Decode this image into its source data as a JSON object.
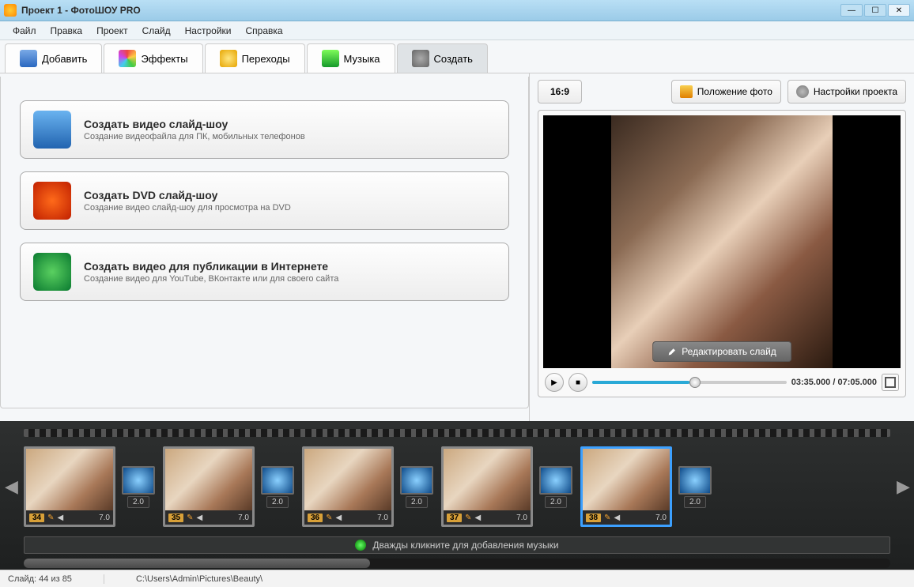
{
  "window": {
    "title": "Проект 1 - ФотоШОУ PRO"
  },
  "menu": [
    "Файл",
    "Правка",
    "Проект",
    "Слайд",
    "Настройки",
    "Справка"
  ],
  "tabs": [
    {
      "label": "Добавить",
      "icon_color": "linear-gradient(#7aa9e6,#2a68c0)"
    },
    {
      "label": "Эффекты",
      "icon_color": "conic-gradient(#e44,#fc4,#4c4,#4ce,#c4e,#e44)"
    },
    {
      "label": "Переходы",
      "icon_color": "radial-gradient(#ffe680,#e6a400)"
    },
    {
      "label": "Музыка",
      "icon_color": "linear-gradient(#7efc5a,#15992a)"
    },
    {
      "label": "Создать",
      "icon_color": "radial-gradient(#aaa,#666)"
    }
  ],
  "active_tab": 4,
  "create_options": [
    {
      "title": "Создать видео слайд-шоу",
      "desc": "Создание видеофайла для ПК, мобильных телефонов",
      "icon": "linear-gradient(#6ab3f0,#2264b0)"
    },
    {
      "title": "Создать DVD слайд-шоу",
      "desc": "Создание видео слайд-шоу для просмотра на DVD",
      "icon": "radial-gradient(#ff6a1a,#c02000)"
    },
    {
      "title": "Создать видео для публикации в Интернете",
      "desc": "Создание видео для YouTube, ВКонтакте или для своего сайта",
      "icon": "radial-gradient(#5ad060,#0a7a30)"
    }
  ],
  "right_toolbar": {
    "aspect": "16:9",
    "photo_position": "Положение фото",
    "project_settings": "Настройки проекта"
  },
  "preview": {
    "edit_label": "Редактировать слайд",
    "current_time": "03:35.000",
    "total_time": "07:05.000",
    "progress_pct": 50
  },
  "timeline": {
    "slides": [
      {
        "index": 34,
        "duration": "7.0",
        "trans": "2.0"
      },
      {
        "index": 35,
        "duration": "7.0",
        "trans": "2.0"
      },
      {
        "index": 36,
        "duration": "7.0",
        "trans": "2.0"
      },
      {
        "index": 37,
        "duration": "7.0",
        "trans": "2.0"
      },
      {
        "index": 38,
        "duration": "7.0",
        "trans": "2.0"
      }
    ],
    "selected_index": 38,
    "music_hint": "Дважды кликните для добавления музыки"
  },
  "status": {
    "slide_text_prefix": "Слайд: ",
    "slide_pos": "44 из 85",
    "path": "C:\\Users\\Admin\\Pictures\\Beauty\\"
  }
}
